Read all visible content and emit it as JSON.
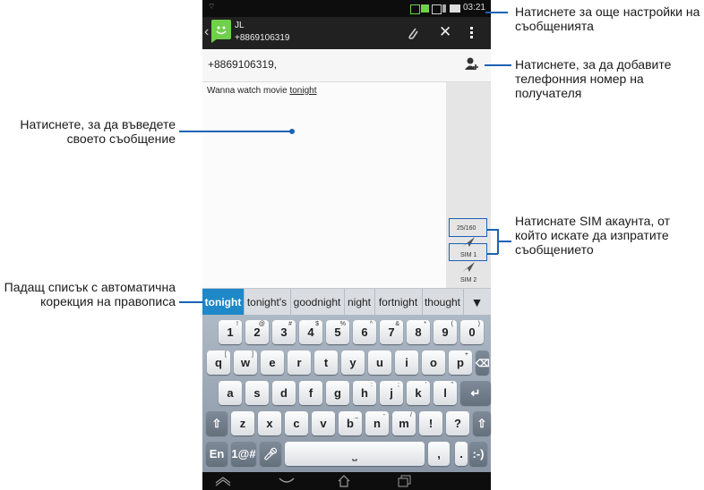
{
  "status_bar": {
    "time": "03:21"
  },
  "action_bar": {
    "contact_name": "JL",
    "contact_number": "+8869106319"
  },
  "recipient_field": {
    "value": "+8869106319,"
  },
  "message": {
    "text_before": "Wanna watch movie ",
    "text_underlined": "tonight"
  },
  "send_panel": {
    "char_count": "25/160",
    "sim1_label": "SIM 1",
    "sim2_label": "SIM 2"
  },
  "suggestions": [
    "tonight",
    "tonight's",
    "goodnight",
    "night",
    "fortnight",
    "thought"
  ],
  "keyboard": {
    "row1": [
      {
        "k": "1",
        "s": "!"
      },
      {
        "k": "2",
        "s": "@"
      },
      {
        "k": "3",
        "s": "#"
      },
      {
        "k": "4",
        "s": "$"
      },
      {
        "k": "5",
        "s": "%"
      },
      {
        "k": "6",
        "s": "^"
      },
      {
        "k": "7",
        "s": "&"
      },
      {
        "k": "8",
        "s": "*"
      },
      {
        "k": "9",
        "s": "("
      },
      {
        "k": "0",
        "s": ")"
      }
    ],
    "row2": [
      {
        "k": "q",
        "s": "["
      },
      {
        "k": "w",
        "s": "]"
      },
      {
        "k": "e",
        "s": ""
      },
      {
        "k": "r",
        "s": ""
      },
      {
        "k": "t",
        "s": ""
      },
      {
        "k": "y",
        "s": ""
      },
      {
        "k": "u",
        "s": ""
      },
      {
        "k": "i",
        "s": ""
      },
      {
        "k": "o",
        "s": ""
      },
      {
        "k": "p",
        "s": "+"
      }
    ],
    "row3": [
      {
        "k": "a",
        "s": ""
      },
      {
        "k": "s",
        "s": ""
      },
      {
        "k": "d",
        "s": ""
      },
      {
        "k": "f",
        "s": ""
      },
      {
        "k": "g",
        "s": ""
      },
      {
        "k": "h",
        "s": ":"
      },
      {
        "k": "j",
        "s": ";"
      },
      {
        "k": "k",
        "s": "'"
      },
      {
        "k": "l",
        "s": "\""
      }
    ],
    "row4": [
      {
        "k": "z",
        "s": ""
      },
      {
        "k": "x",
        "s": ""
      },
      {
        "k": "c",
        "s": ""
      },
      {
        "k": "v",
        "s": ""
      },
      {
        "k": "b",
        "s": "_"
      },
      {
        "k": "n",
        "s": "-"
      },
      {
        "k": "m",
        "s": "/"
      },
      {
        "k": "!",
        "s": ""
      },
      {
        "k": "?",
        "s": ""
      }
    ],
    "lang_key": "En",
    "symbols_key": "1@#",
    "comma_key": ",",
    "period_key": ".",
    "emoticon_key": ":-)"
  },
  "callouts": {
    "settings": "Натиснете за още настройки на съобщенията",
    "add_recipient": "Натиснете, за да добавите телефонния номер на получателя",
    "type_message": "Натиснете, за да въведете своето съобщение",
    "sim_account": "Натиснате SIM акаунта, от който искате да изпратите съобщението",
    "autocorrect": "Падащ списък с автоматична корекция на правописа"
  },
  "colors": {
    "accent": "#1b63b4",
    "suggestion_active": "#1e88c8",
    "avatar": "#6fd14a"
  }
}
